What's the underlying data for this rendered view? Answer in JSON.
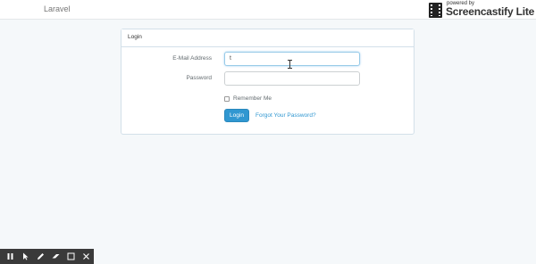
{
  "navbar": {
    "brand": "Laravel"
  },
  "watermark": {
    "line1": "powered by",
    "line2": "Screencastify Lite"
  },
  "panel": {
    "heading": "Login",
    "email": {
      "label": "E-Mail Address",
      "value": "t"
    },
    "password": {
      "label": "Password",
      "value": ""
    },
    "remember": {
      "label": "Remember Me",
      "checked": false
    },
    "login_button": "Login",
    "forgot_link": "Forgot Your Password?"
  },
  "toolbar": {
    "tools": [
      "pause-icon",
      "pointer-icon",
      "pen-icon",
      "highlighter-icon",
      "rectangle-icon",
      "close-icon"
    ]
  },
  "colors": {
    "background": "#f5f8fa",
    "primary": "#3097d1",
    "toolbar": "#3a3a3a"
  }
}
